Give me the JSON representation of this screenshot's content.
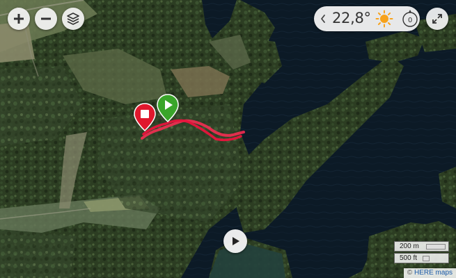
{
  "controls": {
    "zoom_in_icon": "plus-icon",
    "zoom_out_icon": "minus-icon",
    "layers_icon": "layers-icon",
    "fullscreen_icon": "expand-icon"
  },
  "weather": {
    "temperature": "22,8°",
    "condition_icon": "sun-icon",
    "wind_speed": "0",
    "chevron_icon": "chevron-left-icon"
  },
  "route": {
    "start_icon": "play-marker-icon",
    "end_icon": "stop-marker-icon",
    "color": "#e8143c",
    "start_color": "#3aa52a",
    "end_color": "#e0182d"
  },
  "playback": {
    "icon": "play-icon"
  },
  "scale": {
    "metric": "200 m",
    "imperial": "500 ft"
  },
  "attribution": {
    "symbol": "©",
    "provider": "HERE maps"
  }
}
